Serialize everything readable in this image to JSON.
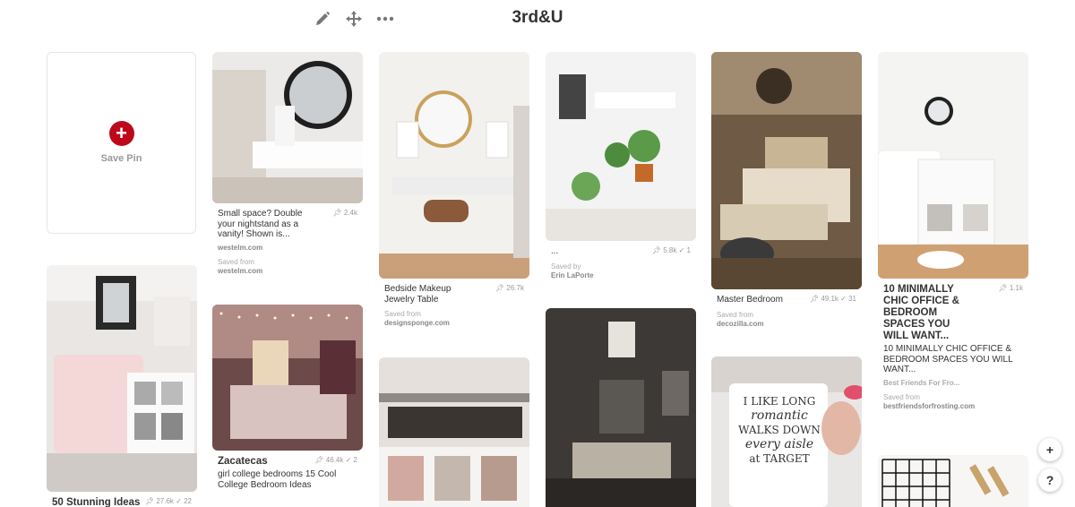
{
  "board": {
    "title": "3rd&U"
  },
  "toolbar": {
    "edit_icon": "pencil-icon",
    "move_icon": "move-icon",
    "more_icon": "more-icon"
  },
  "save_pin": {
    "label": "Save Pin"
  },
  "pins": {
    "p1": {
      "title": "50 Stunning Ideas",
      "saves": "27.6k",
      "checks": "22"
    },
    "p2": {
      "title": "Small space? Double your nightstand as a vanity! Shown is...",
      "saves": "2.4k",
      "source": "westelm.com",
      "saved_from": "Saved from",
      "saved_source": "westelm.com"
    },
    "p3": {
      "title": "Zacatecas",
      "saves": "46.4k",
      "checks": "2",
      "desc": "girl college bedrooms 15 Cool College Bedroom Ideas"
    },
    "p4": {
      "title": "Bedside Makeup Jewelry Table",
      "saves": "26.7k",
      "saved_from": "Saved from",
      "saved_source": "designsponge.com"
    },
    "p5": {
      "title": "...",
      "saves": "5.8k",
      "checks": "1",
      "saved_from": "Saved by",
      "saved_source": "Erin LaPorte"
    },
    "p6": {
      "title": "Master Bedroom",
      "saves": "49.1k",
      "checks": "31",
      "saved_from": "Saved from",
      "saved_source": "decozilla.com"
    },
    "p7": {
      "title": "10 MINIMALLY CHIC OFFICE & BEDROOM SPACES YOU WILL WANT...",
      "saves": "1.1k",
      "desc": "10 MINIMALLY CHIC OFFICE & BEDROOM SPACES YOU WILL WANT...",
      "source": "Best Friends For Fro...",
      "saved_from": "Saved from",
      "saved_source": "bestfriendsforfrosting.com"
    },
    "p8": {
      "mug_text": [
        "I LIKE LONG",
        "romantic",
        "WALKS DOWN",
        "every aisle",
        "at TARGET"
      ]
    }
  },
  "fabs": {
    "add": "+",
    "help": "?"
  },
  "colors": {
    "accent": "#bd081c"
  }
}
